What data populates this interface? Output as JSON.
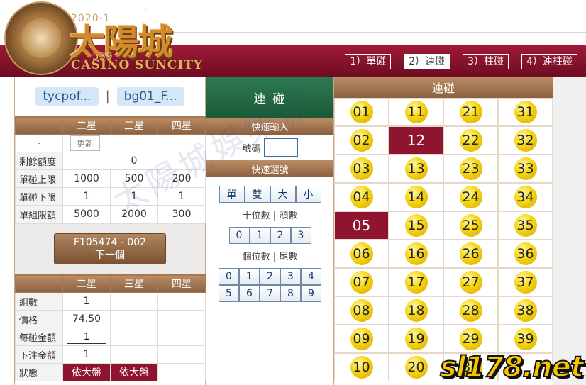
{
  "header": {
    "logo_date": "2020-1",
    "logo_cn": "太陽城",
    "logo_num": "539",
    "logo_en": "CASINO SUNCITY",
    "tabs": [
      {
        "label": "1）單碰",
        "active": false
      },
      {
        "label": "2）連碰",
        "active": true
      },
      {
        "label": "3）柱碰",
        "active": false
      },
      {
        "label": "4）連柱碰",
        "active": false
      }
    ]
  },
  "users": {
    "account": "tycpof...",
    "separator": "|",
    "agent": "bg01_F..."
  },
  "limits": {
    "headers": [
      "",
      "二星",
      "三星",
      "四星"
    ],
    "refresh_row": {
      "label": "-",
      "button": "更新"
    },
    "rows": [
      {
        "label": "剩餘額度",
        "values": [
          "0"
        ]
      },
      {
        "label": "單碰上限",
        "values": [
          "1000",
          "500",
          "200"
        ]
      },
      {
        "label": "單碰下限",
        "values": [
          "1",
          "1",
          "1"
        ]
      },
      {
        "label": "單組限額",
        "values": [
          "5000",
          "2000",
          "300"
        ]
      }
    ]
  },
  "next": {
    "line1": "F105474 - 002",
    "line2": "下一個"
  },
  "bet": {
    "headers": [
      "",
      "二星",
      "三星",
      "四星"
    ],
    "groups_label": "組數",
    "groups_value": "1",
    "price_label": "價格",
    "price_value": "74.50",
    "stake_label": "每碰金額",
    "stake_value": "1",
    "total_label": "下注金額",
    "total_value": "1",
    "status_label": "狀態",
    "status_values": [
      "依大盤",
      "依大盤"
    ]
  },
  "mid": {
    "title": "連 碰",
    "quick_input": "快速輸入",
    "code_label": "號碼",
    "quick_select": "快速選號",
    "type_buttons": [
      "單",
      "雙",
      "大",
      "小"
    ],
    "tens_label": "十位數 | 頭數",
    "tens_buttons": [
      "0",
      "1",
      "2",
      "3"
    ],
    "units_label": "個位數 | 尾數",
    "units_buttons": [
      "0",
      "1",
      "2",
      "3",
      "4",
      "5",
      "6",
      "7",
      "8",
      "9"
    ]
  },
  "numbers": {
    "title": "連碰",
    "selected": [
      "05",
      "12"
    ],
    "rows": [
      [
        "01",
        "11",
        "21",
        "31"
      ],
      [
        "02",
        "12",
        "22",
        "32"
      ],
      [
        "03",
        "13",
        "23",
        "33"
      ],
      [
        "04",
        "14",
        "24",
        "34"
      ],
      [
        "05",
        "15",
        "25",
        "35"
      ],
      [
        "06",
        "16",
        "26",
        "36"
      ],
      [
        "07",
        "17",
        "27",
        "37"
      ],
      [
        "08",
        "18",
        "28",
        "38"
      ],
      [
        "09",
        "19",
        "29",
        "39"
      ],
      [
        "10",
        "20",
        "30",
        ""
      ]
    ]
  },
  "watermark": "太陽城娛樂城",
  "stamp": "sl178.net",
  "colors": {
    "maroon": "#8e1430",
    "brown": "#8b6040",
    "green": "#1b5a38",
    "ball": "#f7d816"
  }
}
